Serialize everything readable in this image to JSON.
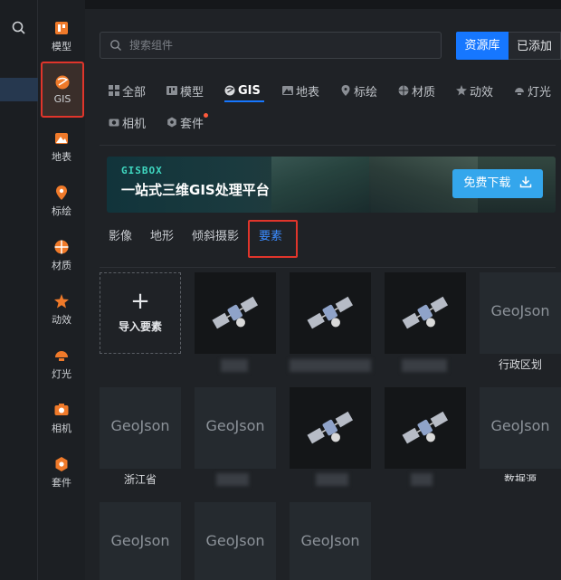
{
  "sidebar": {
    "items": [
      {
        "label": "模型",
        "icon": "model-icon"
      },
      {
        "label": "GIS",
        "icon": "gis-globe-icon"
      },
      {
        "label": "地表",
        "icon": "terrain-icon"
      },
      {
        "label": "标绘",
        "icon": "location-pin-icon"
      },
      {
        "label": "材质",
        "icon": "material-ball-icon"
      },
      {
        "label": "动效",
        "icon": "effect-star-icon"
      },
      {
        "label": "灯光",
        "icon": "light-bulb-icon"
      },
      {
        "label": "相机",
        "icon": "camera-icon"
      },
      {
        "label": "套件",
        "icon": "kit-gear-icon"
      }
    ],
    "active": "GIS"
  },
  "search": {
    "placeholder": "搜索组件"
  },
  "tabs": {
    "library": "资源库",
    "added": "已添加"
  },
  "categories": [
    "全部",
    "模型",
    "GIS",
    "地表",
    "标绘",
    "材质",
    "动效",
    "灯光",
    "相机",
    "套件"
  ],
  "banner": {
    "brand": "GISBOX",
    "slogan": "一站式三维GIS处理平台",
    "download": "免费下载"
  },
  "subtabs": [
    "影像",
    "地形",
    "倾斜摄影",
    "要素"
  ],
  "grid": {
    "import_label": "导入要素",
    "tile_text": "GeoJson",
    "captions": {
      "admin": "行政区划",
      "zhejiang": "浙江省",
      "data": "数据源"
    }
  },
  "colors": {
    "accent": "#1677ff",
    "highlight": "#e0352b",
    "banner_button": "#34a6ec"
  }
}
